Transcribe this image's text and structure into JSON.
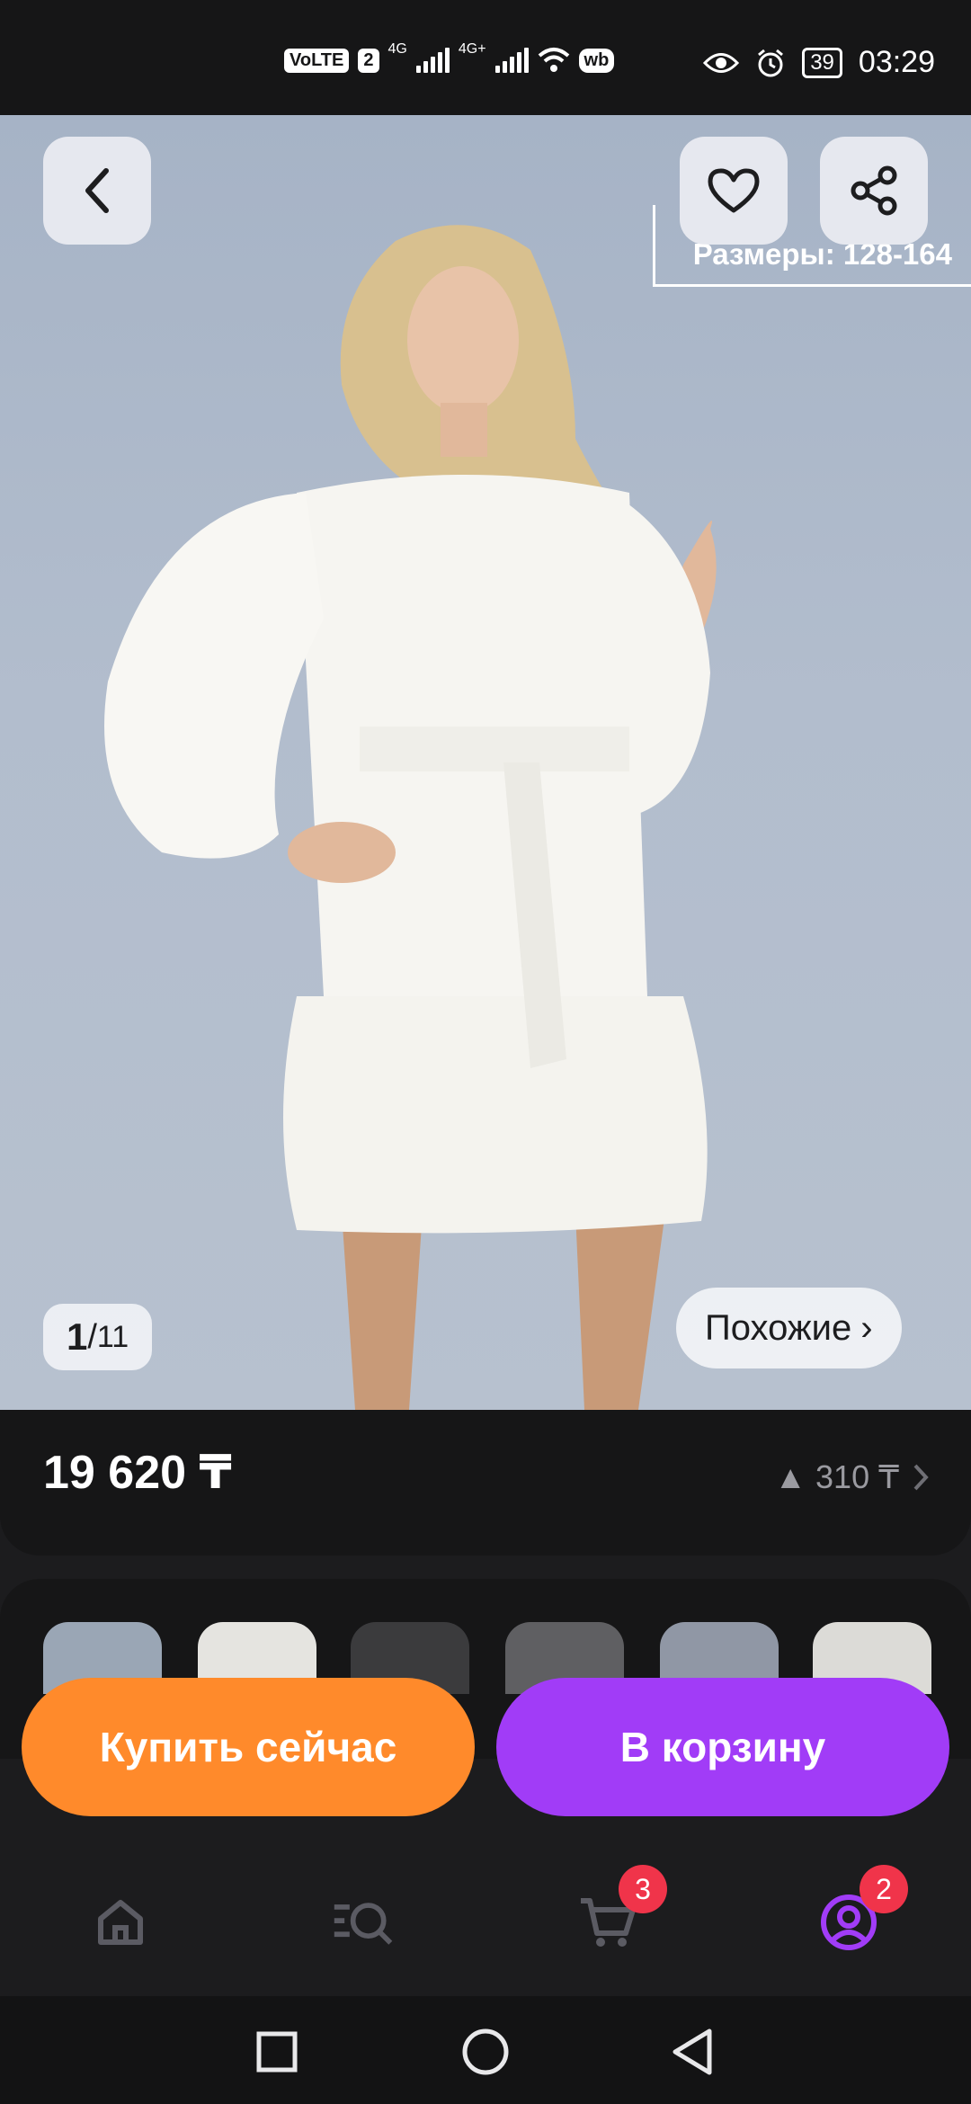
{
  "status_bar": {
    "volte": "VoLTE",
    "sim": "2",
    "net1": "4G",
    "net2": "4G+",
    "wb": "wb",
    "battery": "39",
    "time": "03:29"
  },
  "hero": {
    "sizes_label": "Размеры: 128-164",
    "counter_current": "1",
    "counter_sep": "/",
    "counter_total": "11",
    "similar_label": "Похожие",
    "similar_chevron": "›"
  },
  "price": {
    "value": "19 620 ₸",
    "diff": "▲ 310 ₸"
  },
  "actions": {
    "buy_now": "Купить сейчас",
    "add_to_cart": "В корзину"
  },
  "tabbar": {
    "cart_badge": "3",
    "profile_badge": "2"
  },
  "colors": {
    "accent_orange": "#ff8a2b",
    "accent_purple": "#a13cf7",
    "badge_red": "#f0344a"
  }
}
